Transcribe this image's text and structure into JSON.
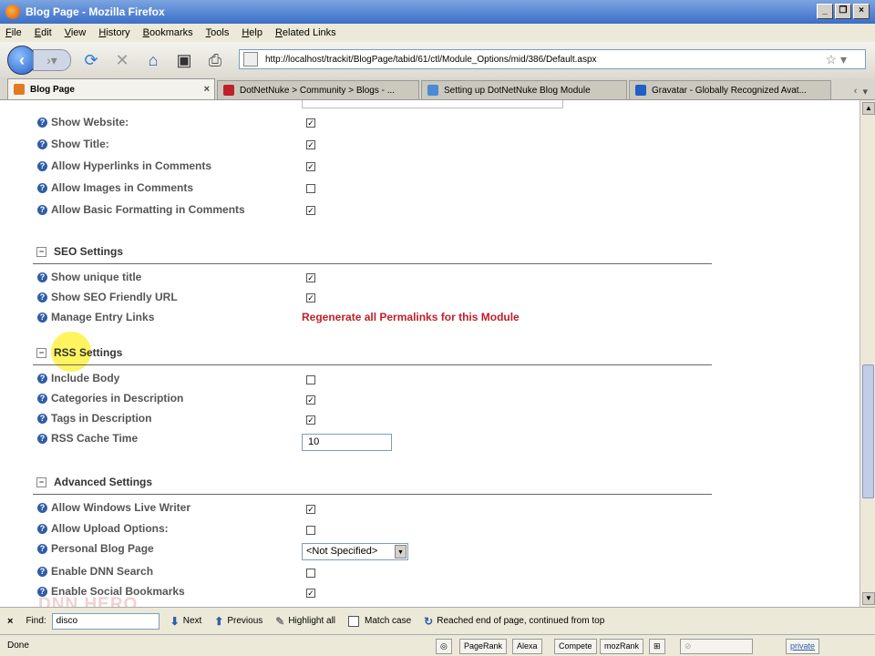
{
  "window": {
    "title": "Blog Page - Mozilla Firefox"
  },
  "menu": [
    "File",
    "Edit",
    "View",
    "History",
    "Bookmarks",
    "Tools",
    "Help",
    "Related Links"
  ],
  "navbar": {
    "url": "http://localhost/trackit/BlogPage/tabid/61/ctl/Module_Options/mid/386/Default.aspx"
  },
  "tabs": [
    {
      "label": "Blog Page",
      "active": true,
      "color": "#e07b20"
    },
    {
      "label": "DotNetNuke > Community > Blogs - ...",
      "active": false,
      "color": "#c0202a"
    },
    {
      "label": "Setting up DotNetNuke Blog Module",
      "active": false,
      "color": "#4a8ad8"
    },
    {
      "label": "Gravatar - Globally Recognized Avat...",
      "active": false,
      "color": "#1f5fc6"
    }
  ],
  "comment_settings": [
    {
      "label": "Show Website:",
      "checked": true
    },
    {
      "label": "Show Title:",
      "checked": true
    },
    {
      "label": "Allow Hyperlinks in Comments",
      "checked": true
    },
    {
      "label": "Allow Images in Comments",
      "checked": false
    },
    {
      "label": "Allow Basic Formatting in Comments",
      "checked": true
    }
  ],
  "seo": {
    "title": "SEO Settings",
    "items": [
      {
        "label": "Show unique title",
        "checked": true
      },
      {
        "label": "Show SEO Friendly URL",
        "checked": true
      },
      {
        "label": "Manage Entry Links"
      }
    ],
    "regenerate_label": "Regenerate all Permalinks for this Module"
  },
  "rss": {
    "title": "RSS Settings",
    "items": [
      {
        "label": "Include Body",
        "checked": false
      },
      {
        "label": "Categories in Description",
        "checked": true
      },
      {
        "label": "Tags in Description",
        "checked": true
      },
      {
        "label": "RSS Cache Time"
      }
    ],
    "cache_time_value": "10"
  },
  "advanced": {
    "title": "Advanced Settings",
    "items": [
      {
        "label": "Allow Windows Live Writer",
        "checked": true
      },
      {
        "label": "Allow Upload Options:",
        "checked": false
      },
      {
        "label": "Personal Blog Page"
      },
      {
        "label": "Enable DNN Search",
        "checked": false
      },
      {
        "label": "Enable Social Bookmarks",
        "checked": true
      }
    ],
    "personal_blog_page_value": "<Not Specified>"
  },
  "watermark": "DNN HERO",
  "findbar": {
    "find_label": "Find:",
    "query": "disco",
    "next_label": "Next",
    "previous_label": "Previous",
    "highlight_label": "Highlight all",
    "match_case_label": "Match case",
    "message": "Reached end of page, continued from top"
  },
  "statusbar": {
    "status": "Done",
    "badges": [
      "PageRank",
      "Alexa",
      "Compete",
      "mozRank"
    ],
    "private_label": "private"
  }
}
